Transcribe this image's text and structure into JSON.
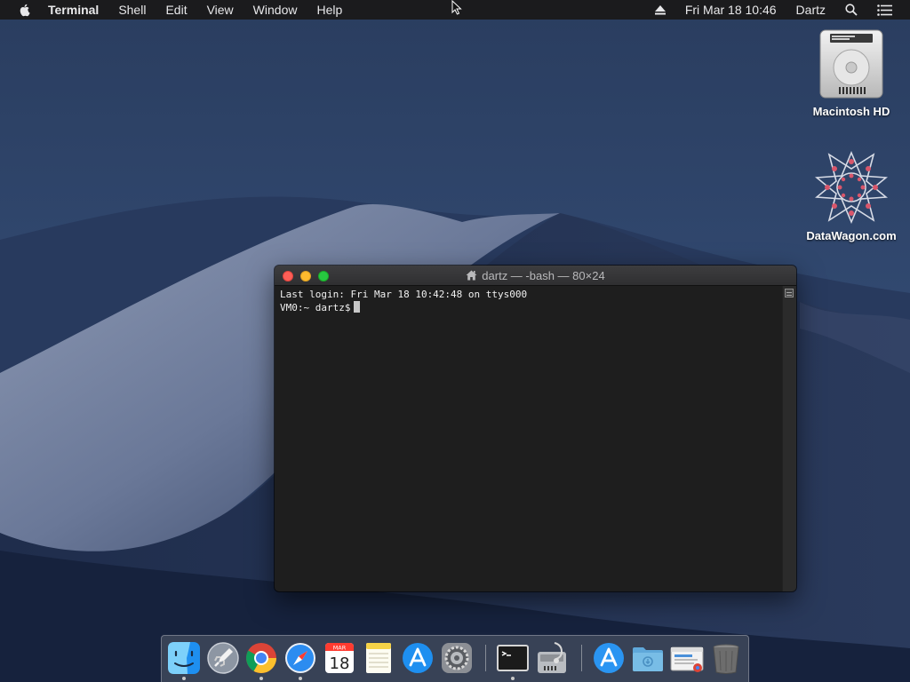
{
  "menubar": {
    "app_name": "Terminal",
    "menus": [
      "Shell",
      "Edit",
      "View",
      "Window",
      "Help"
    ],
    "date": "Fri Mar 18",
    "time": "10:46",
    "user": "Dartz",
    "icons": [
      "apple-icon",
      "eject-icon",
      "spotlight-search-icon",
      "notification-center-icon"
    ]
  },
  "desktop": {
    "icons": [
      {
        "label": "Macintosh HD",
        "icon": "hard-drive-icon"
      },
      {
        "label": "DataWagon.com",
        "icon": "datawagon-logo-icon"
      }
    ]
  },
  "terminal": {
    "title": "dartz — -bash — 80×24",
    "lines": [
      "Last login: Fri Mar 18 10:42:48 on ttys000",
      "VM0:~ dartz$"
    ]
  },
  "dock": {
    "items": [
      {
        "name": "finder",
        "running": true
      },
      {
        "name": "launchpad",
        "running": false
      },
      {
        "name": "chrome",
        "running": true
      },
      {
        "name": "safari",
        "running": true
      },
      {
        "name": "calendar",
        "running": false,
        "month": "MAR",
        "day": "18"
      },
      {
        "name": "notes",
        "running": false
      },
      {
        "name": "app-store",
        "running": false
      },
      {
        "name": "system-preferences",
        "running": false
      },
      {
        "name": "terminal",
        "running": true
      },
      {
        "name": "disk-utility",
        "running": false
      },
      {
        "name": "app-store-folder",
        "running": false
      },
      {
        "name": "downloads-folder",
        "running": false
      },
      {
        "name": "chrome-window",
        "running": false
      },
      {
        "name": "trash",
        "running": false
      }
    ]
  }
}
